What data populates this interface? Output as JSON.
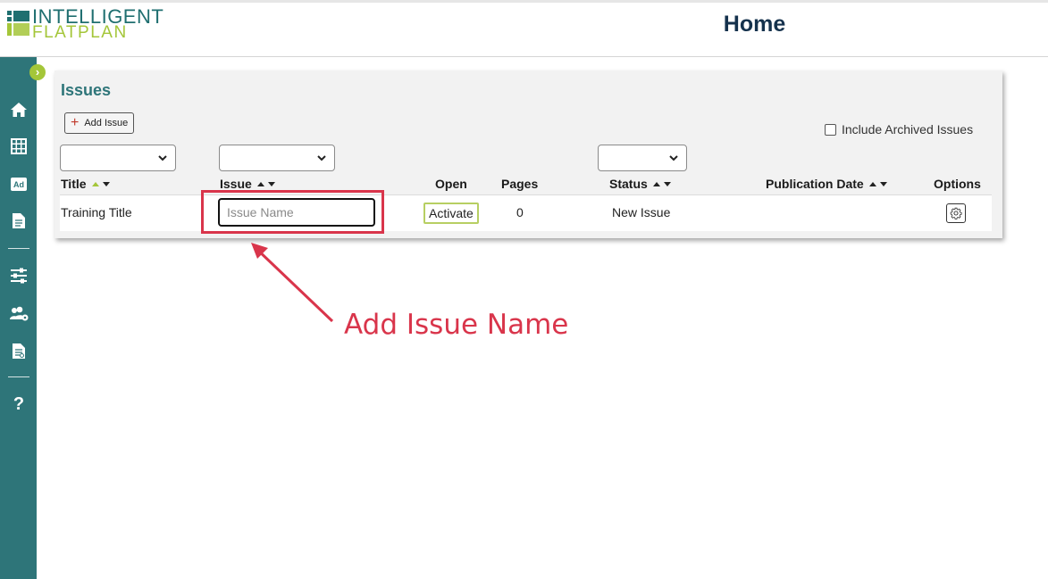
{
  "app": {
    "logo_line1": "INTELLIGENT",
    "logo_line2": "FLATPLAN",
    "page_title": "Home"
  },
  "colors": {
    "brand_teal": "#2e7579",
    "brand_green": "#a4c639",
    "title_navy": "#15324d",
    "annotation_red": "#d9354b"
  },
  "sidebar": {
    "items": [
      {
        "icon": "home-icon"
      },
      {
        "icon": "flatplan-grid-icon"
      },
      {
        "icon": "ad-icon",
        "label": "Ad"
      },
      {
        "icon": "document-icon"
      },
      {
        "icon": "settings-sliders-icon"
      },
      {
        "icon": "users-settings-icon"
      },
      {
        "icon": "report-icon"
      },
      {
        "icon": "help-icon",
        "label": "?"
      }
    ]
  },
  "issues_panel": {
    "title": "Issues",
    "add_button": "Add Issue",
    "include_archived_label": "Include Archived Issues",
    "include_archived_checked": false,
    "columns": {
      "title": "Title",
      "issue": "Issue",
      "open": "Open",
      "pages": "Pages",
      "status": "Status",
      "publication_date": "Publication Date",
      "options": "Options"
    },
    "row": {
      "title": "Training Title",
      "issue_placeholder": "Issue Name",
      "open_button": "Activate",
      "pages": "0",
      "status": "New Issue",
      "publication_date": ""
    }
  },
  "annotation": {
    "text": "Add Issue Name"
  }
}
